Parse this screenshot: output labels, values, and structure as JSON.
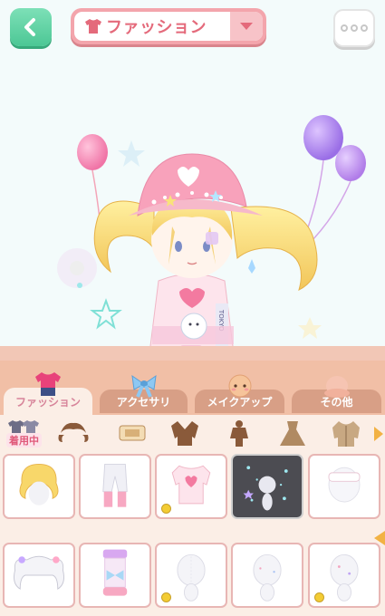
{
  "header": {
    "title": "ファッション",
    "back_icon": "chevron-left-icon",
    "more_icon": "more-dots-icon",
    "dropdown_icon": "chevron-down-icon",
    "title_icon": "tshirt-icon"
  },
  "tabs": [
    {
      "label": "ファッション",
      "icon": "clothes-icon",
      "active": true
    },
    {
      "label": "アクセサリ",
      "icon": "ribbon-icon",
      "active": false
    },
    {
      "label": "メイクアップ",
      "icon": "face-icon",
      "active": false
    },
    {
      "label": "その他",
      "icon": "other-icon",
      "active": false
    }
  ],
  "categories": {
    "wearing_label": "着用中",
    "items": [
      "hair-icon",
      "hat-icon",
      "jacket-icon",
      "onepiece-icon",
      "dress-icon",
      "coat-icon"
    ]
  },
  "items": [
    {
      "name": "blonde-hair",
      "badge": false,
      "selected": false
    },
    {
      "name": "white-pants",
      "badge": false,
      "selected": false
    },
    {
      "name": "pink-heart-top",
      "badge": true,
      "selected": false
    },
    {
      "name": "sparkle-background",
      "badge": true,
      "selected": true
    },
    {
      "name": "white-glasses",
      "badge": false,
      "selected": false
    },
    {
      "name": "white-twin-hair",
      "badge": false,
      "selected": false
    },
    {
      "name": "pastel-boots",
      "badge": false,
      "selected": false
    },
    {
      "name": "white-body-1",
      "badge": true,
      "selected": false
    },
    {
      "name": "white-body-2",
      "badge": false,
      "selected": false
    },
    {
      "name": "white-body-3",
      "badge": true,
      "selected": false
    }
  ],
  "colors": {
    "accent": "#e46a7b",
    "back_button": "#4cc795",
    "tab_bar": "#f1bfa6",
    "panel": "#fbeee6"
  }
}
